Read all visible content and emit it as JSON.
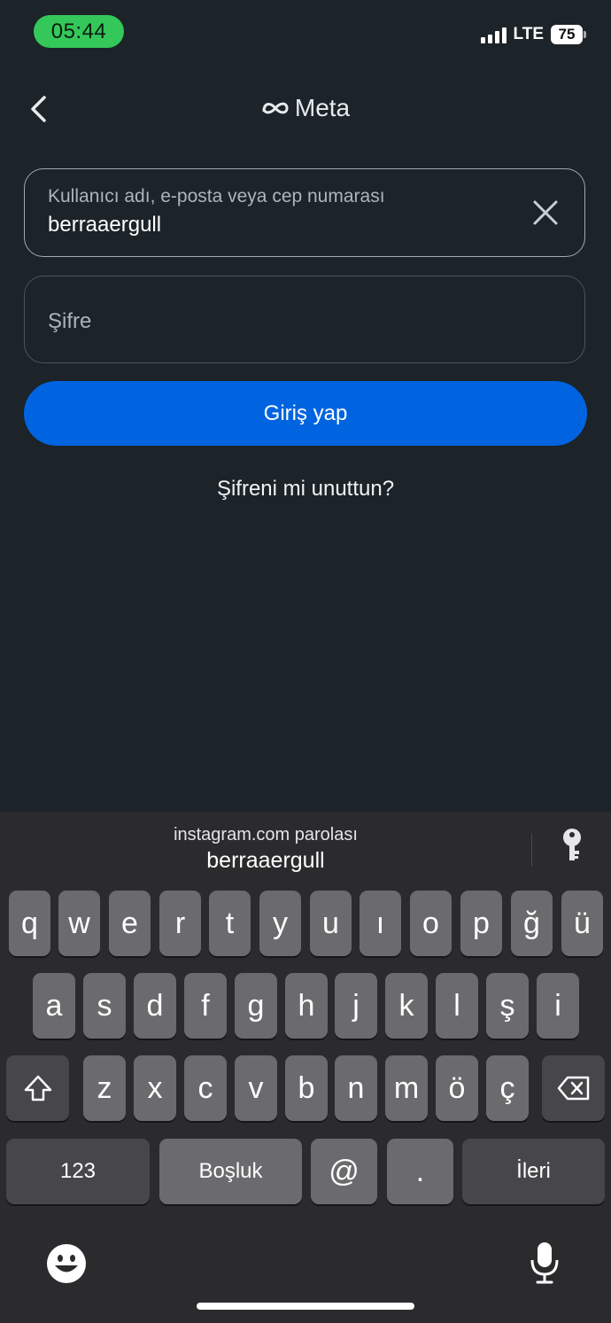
{
  "status_bar": {
    "time": "05:44",
    "network": "LTE",
    "battery": "75"
  },
  "header": {
    "brand": "Meta"
  },
  "login": {
    "username_label": "Kullanıcı adı, e-posta veya cep numarası",
    "username_value": "berraaergull",
    "password_placeholder": "Şifre",
    "login_button": "Giriş yap",
    "forgot_link": "Şifreni mi unuttun?"
  },
  "keyboard": {
    "suggestion_title": "instagram.com parolası",
    "suggestion_user": "berraaergull",
    "row1": [
      "q",
      "w",
      "e",
      "r",
      "t",
      "y",
      "u",
      "ı",
      "o",
      "p",
      "ğ",
      "ü"
    ],
    "row2": [
      "a",
      "s",
      "d",
      "f",
      "g",
      "h",
      "j",
      "k",
      "l",
      "ş",
      "i"
    ],
    "row3": [
      "z",
      "x",
      "c",
      "v",
      "b",
      "n",
      "m",
      "ö",
      "ç"
    ],
    "numbers_key": "123",
    "space_key": "Boşluk",
    "at_key": "@",
    "dot_key": ".",
    "next_key": "İleri"
  }
}
